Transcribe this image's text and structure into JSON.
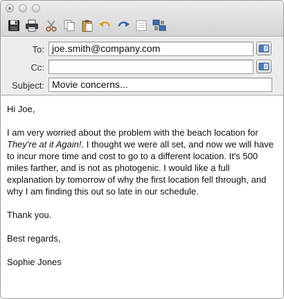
{
  "window": {
    "buttons": [
      "close",
      "minimize",
      "zoom"
    ]
  },
  "toolbar": {
    "items": [
      {
        "name": "save",
        "icon": "floppy-disk-icon"
      },
      {
        "name": "print",
        "icon": "printer-icon"
      },
      {
        "name": "cut",
        "icon": "scissors-icon"
      },
      {
        "name": "copy",
        "icon": "copy-icon"
      },
      {
        "name": "paste",
        "icon": "clipboard-icon"
      },
      {
        "name": "undo",
        "icon": "undo-arrow-icon"
      },
      {
        "name": "redo",
        "icon": "redo-arrow-icon"
      },
      {
        "name": "format",
        "icon": "document-icon"
      },
      {
        "name": "network",
        "icon": "network-computers-icon"
      }
    ]
  },
  "header": {
    "to_label": "To:",
    "to_value": "joe.smith@company.com",
    "cc_label": "Cc:",
    "cc_value": "",
    "subject_label": "Subject:",
    "subject_value": "Movie concerns..."
  },
  "message": {
    "greeting": "Hi Joe,",
    "para1_a": "I am very worried about the problem with the beach location for",
    "para1_title": "They're at it Again!",
    "para1_b": ".  I thought we were all set, and now we will have to incur more time and cost to go to a different location. It's 500 miles farther, and is not as photogenic. I would like a full explanation by tomorrow of why the first location fell through, and why I am finding this out so late in our schedule.",
    "thanks": "Thank you.",
    "closing": "Best regards,",
    "signature": "Sophie Jones"
  },
  "colors": {
    "chrome_top": "#ececec",
    "chrome_bottom": "#d4d4d4",
    "field_border": "#9d9d9d"
  }
}
